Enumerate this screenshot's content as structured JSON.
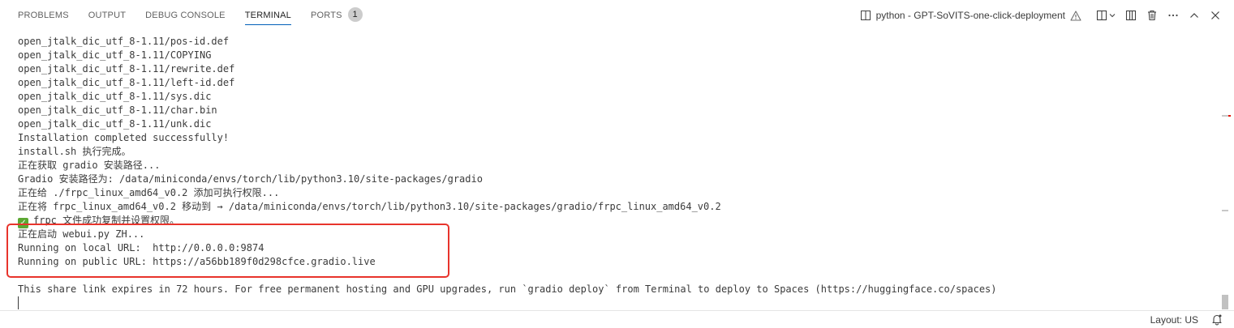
{
  "tabs": [
    {
      "label": "PROBLEMS"
    },
    {
      "label": "OUTPUT"
    },
    {
      "label": "DEBUG CONSOLE"
    },
    {
      "label": "TERMINAL",
      "active": true
    },
    {
      "label": "PORTS",
      "badge": "1"
    }
  ],
  "terminal_instance": {
    "label": "python - GPT-SoVITS-one-click-deployment",
    "icon": "terminal-icon",
    "warning_icon": "warning-icon"
  },
  "actions": [
    {
      "name": "split-terminal-button",
      "icon": "split-icon"
    },
    {
      "name": "kill-terminal-button",
      "icon": "trash-icon"
    },
    {
      "name": "more-actions-button",
      "icon": "ellipsis-icon"
    },
    {
      "name": "maximize-panel-button",
      "icon": "chevron-up-icon"
    },
    {
      "name": "close-panel-button",
      "icon": "close-icon"
    }
  ],
  "terminal": {
    "lines": [
      "open_jtalk_dic_utf_8-1.11/pos-id.def",
      "open_jtalk_dic_utf_8-1.11/COPYING",
      "open_jtalk_dic_utf_8-1.11/rewrite.def",
      "open_jtalk_dic_utf_8-1.11/left-id.def",
      "open_jtalk_dic_utf_8-1.11/sys.dic",
      "open_jtalk_dic_utf_8-1.11/char.bin",
      "open_jtalk_dic_utf_8-1.11/unk.dic",
      "Installation completed successfully!",
      "install.sh 执行完成。",
      "正在获取 gradio 安装路径...",
      "Gradio 安装路径为: /data/miniconda/envs/torch/lib/python3.10/site-packages/gradio",
      "正在给 ./frpc_linux_amd64_v0.2 添加可执行权限...",
      "正在将 frpc_linux_amd64_v0.2 移动到 → /data/miniconda/envs/torch/lib/python3.10/site-packages/gradio/frpc_linux_amd64_v0.2",
      "frpc 文件成功复制并设置权限。",
      "正在启动 webui.py ZH...",
      "Running on local URL:  http://0.0.0.0:9874",
      "Running on public URL: https://a56bb189f0d298cfce.gradio.live",
      "",
      "This share link expires in 72 hours. For free permanent hosting and GPU upgrades, run `gradio deploy` from Terminal to deploy to Spaces (https://huggingface.co/spaces)"
    ]
  },
  "status": {
    "layout": "Layout: US",
    "notification_icon": "bell-icon"
  },
  "colors": {
    "highlight_box": "#e8342c",
    "check_mark": "#5ca833",
    "active_tab_underline": "#005fb8",
    "warning": "#6c6c6c"
  }
}
